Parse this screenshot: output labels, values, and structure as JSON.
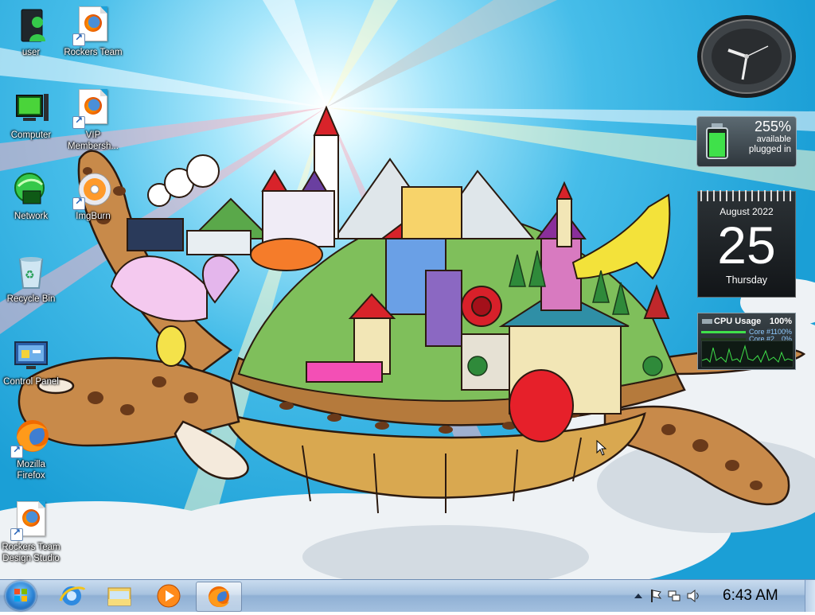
{
  "desktop": {
    "icons": [
      {
        "label": "user"
      },
      {
        "label": "Rockers Team"
      },
      {
        "label": "Computer"
      },
      {
        "label": "VIP Membersh..."
      },
      {
        "label": "Network"
      },
      {
        "label": "ImgBurn"
      },
      {
        "label": "Recycle Bin"
      },
      {
        "label": "Control Panel"
      },
      {
        "label": "Mozilla Firefox"
      },
      {
        "label": "Rockers Team Design Studio"
      }
    ]
  },
  "gadgets": {
    "battery": {
      "percent": "255%",
      "line1": "available",
      "line2": "plugged in"
    },
    "calendar": {
      "month": "August 2022",
      "day": "25",
      "weekday": "Thursday"
    },
    "cpu": {
      "title": "CPU Usage",
      "total": "100%",
      "cores": [
        {
          "name": "Core #1",
          "value": "100%",
          "level": 1.0
        },
        {
          "name": "Core #2",
          "value": "0%",
          "level": 0.0
        }
      ]
    }
  },
  "taskbar": {
    "pinned": [
      {
        "icon": "start-orb-icon"
      },
      {
        "icon": "internet-explorer-icon"
      },
      {
        "icon": "windows-explorer-icon"
      },
      {
        "icon": "media-player-icon"
      },
      {
        "icon": "firefox-icon"
      }
    ],
    "tray_icons": [
      "show-hidden-icons-arrow",
      "action-center-flag-icon",
      "network-icon",
      "volume-icon"
    ],
    "clock": "6:43 AM"
  },
  "colors": {
    "sky": "#1b9fd6",
    "taskbar": "#a7c2df",
    "gadget_dark": "#2e363c",
    "cpu_green": "#3fe14a"
  }
}
